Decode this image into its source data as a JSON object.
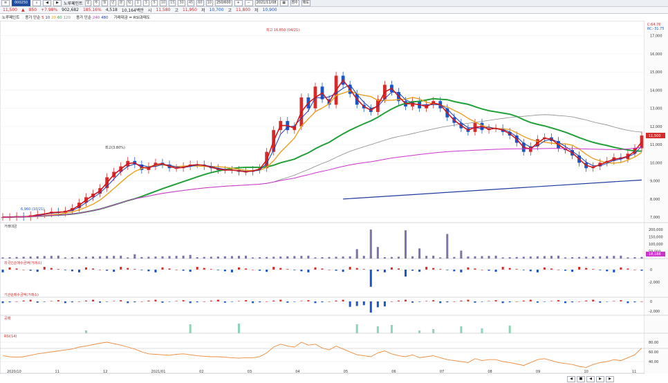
{
  "toolbar": {
    "code": "000250",
    "name": "노루페인트",
    "period_buttons": [
      "일",
      "주",
      "월",
      "년",
      "분",
      "틱"
    ],
    "active_period": "일",
    "minute_steps": [
      "1",
      "3",
      "5",
      "10",
      "15",
      "30",
      "45",
      "60",
      "10"
    ],
    "count": "250/600",
    "date": "2021/11/08",
    "check": "점수",
    "setting": "매도"
  },
  "quote": {
    "price": "11,500",
    "change": "850",
    "change_pct": "+7.98%",
    "volume": "902,682",
    "vol_ratio": "185.16%",
    "value": "4,518",
    "shares": "10,164백만",
    "open_label": "시",
    "open": "11,580",
    "high_label": "고",
    "high": "11,950",
    "low_label": "저",
    "low": "10,700",
    "prev_label": "고",
    "prev": "11,800",
    "close_label": "저",
    "close": "10,900"
  },
  "legend": {
    "item1": "노루페인트",
    "ma_label": "종가 단순",
    "ma1": "5",
    "ma2": "10",
    "ma3": "20",
    "ma4": "60",
    "ma5": "120",
    "ma_label2": "종가 단순",
    "ma6": "240",
    "ma7": "480",
    "extra": "가래대금 = RSI과매도"
  },
  "colors": {
    "up": "#d52b2b",
    "down": "#1b56c6",
    "ma5": "#d0161b",
    "ma10": "#1a3cb8",
    "ma20": "#e8a020",
    "ma60": "#21a038",
    "ma120": "#8a8a8a",
    "ma240": "#cc33cc",
    "ma480": "#1f3c9e",
    "volume": "#7b74a8",
    "rsi": "#ef8a3a"
  },
  "chart_data": {
    "type": "candlestick",
    "price_axis": [
      "17,000",
      "16,000",
      "15,000",
      "14,000",
      "13,000",
      "12,000",
      "11,000",
      "10,000",
      "9,000",
      "8,000",
      "7,000"
    ],
    "ylim": [
      6700,
      17600
    ],
    "x_labels": [
      "2020/10",
      "11",
      "12",
      "2021/01",
      "02",
      "03",
      "04",
      "05",
      "06",
      "07",
      "08",
      "09",
      "10",
      "11"
    ],
    "top_right": [
      "C:64.76",
      "RC:-31.75"
    ],
    "current_price_tag": "11,500",
    "high_annotation": "최고 16,850 (04/21)",
    "low_annotation": "6,960 (10/21)",
    "mid_annotation": "최고(3.80%)",
    "close_path": [
      7000,
      7000,
      7050,
      7000,
      7100,
      7150,
      7200,
      7300,
      7250,
      7350,
      7500,
      7800,
      8100,
      8300,
      8600,
      9200,
      9500,
      9800,
      10100,
      9900,
      9600,
      9800,
      10000,
      9900,
      9700,
      9700,
      9800,
      9900,
      9900,
      9800,
      9700,
      9600,
      9600,
      9600,
      9500,
      9500,
      9600,
      9700,
      10600,
      11800,
      12300,
      11800,
      12000,
      13600,
      13000,
      14200,
      13500,
      13200,
      14800,
      14300,
      13800,
      13200,
      13000,
      12800,
      13500,
      14300,
      13900,
      13400,
      13100,
      13400,
      13000,
      13200,
      13400,
      13000,
      12500,
      12200,
      11900,
      11700,
      12200,
      11800,
      11900,
      11900,
      11700,
      11500,
      11100,
      10600,
      10900,
      11300,
      11400,
      11200,
      10800,
      10700,
      10400,
      10000,
      9700,
      9800,
      10000,
      10100,
      10300,
      10200,
      10500,
      10800,
      11500
    ],
    "volume_axis": [
      "200,000",
      "150,000",
      "100,000",
      "50,000"
    ],
    "volume_tag": "18,188",
    "volume_label": "거래대금",
    "volume_spikes": [
      {
        "idx": 53,
        "v": 200000
      },
      {
        "idx": 58,
        "v": 195000
      },
      {
        "idx": 64,
        "v": 170000
      },
      {
        "idx": 51,
        "v": 65000
      },
      {
        "idx": 54,
        "v": 80000
      },
      {
        "idx": 60,
        "v": 70000
      },
      {
        "idx": 66,
        "v": 55000
      },
      {
        "idx": 19,
        "v": 30000
      },
      {
        "idx": 27,
        "v": 25000
      }
    ],
    "foreign_label": "외국인순매수금액(거래소)",
    "foreign_axis": [
      "0",
      "-2,000"
    ],
    "inst_label": "기관순매수금액(거래소)",
    "inst_axis": [
      "0",
      "-2,000"
    ],
    "extra_label": "공매",
    "rsi_label": "RSI(14)",
    "rsi_axis": [
      "80.00",
      "60.00",
      "40.00"
    ],
    "rsi_series": [
      52,
      50,
      49,
      50,
      53,
      56,
      58,
      60,
      62,
      64,
      66,
      70,
      72,
      75,
      78,
      80,
      77,
      74,
      70,
      66,
      60,
      56,
      55,
      54,
      53,
      55,
      56,
      54,
      52,
      51,
      50,
      50,
      49,
      48,
      47,
      48,
      48,
      50,
      58,
      70,
      76,
      72,
      70,
      80,
      74,
      76,
      68,
      64,
      72,
      66,
      60,
      54,
      52,
      50,
      58,
      62,
      56,
      52,
      50,
      54,
      48,
      50,
      52,
      48,
      44,
      42,
      40,
      38,
      46,
      42,
      44,
      44,
      40,
      38,
      35,
      32,
      38,
      44,
      46,
      42,
      38,
      36,
      34,
      30,
      28,
      34,
      38,
      40,
      44,
      42,
      48,
      54,
      68
    ]
  },
  "nav": {
    "buttons": [
      "◀",
      "■",
      "◀",
      "▶",
      "▶"
    ]
  }
}
